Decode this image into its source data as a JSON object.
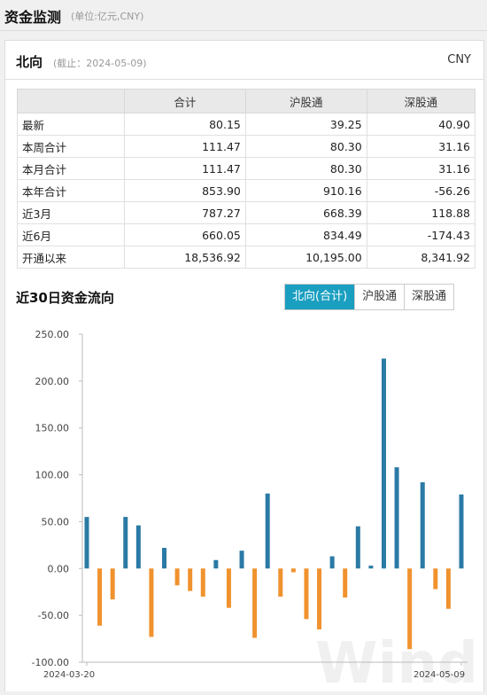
{
  "header": {
    "title": "资金监测",
    "unit": "(单位:亿元,CNY)"
  },
  "north": {
    "title": "北向",
    "as_of": "(截止：2024-05-09)",
    "currency": "CNY",
    "columns": [
      "",
      "合计",
      "沪股通",
      "深股通"
    ],
    "rows": [
      [
        "最新",
        "80.15",
        "39.25",
        "40.90"
      ],
      [
        "本周合计",
        "111.47",
        "80.30",
        "31.16"
      ],
      [
        "本月合计",
        "111.47",
        "80.30",
        "31.16"
      ],
      [
        "本年合计",
        "853.90",
        "910.16",
        "-56.26"
      ],
      [
        "近3月",
        "787.27",
        "668.39",
        "118.88"
      ],
      [
        "近6月",
        "660.05",
        "834.49",
        "-174.43"
      ],
      [
        "开通以来",
        "18,536.92",
        "10,195.00",
        "8,341.92"
      ]
    ]
  },
  "flow": {
    "title": "近30日资金流向",
    "tabs": [
      "北向(合计)",
      "沪股通",
      "深股通"
    ],
    "active_tab": 0
  },
  "colors": {
    "positive": "#2a7aa5",
    "negative": "#f0922e",
    "tab_active": "#1a9fc0"
  },
  "watermark": "Wind",
  "chart_data": {
    "type": "bar",
    "x_start_label": "2024-03-20",
    "x_end_label": "2024-05-09",
    "ylim": [
      -100,
      250
    ],
    "yticks": [
      "-100.00",
      "-50.00",
      "0.00",
      "50.00",
      "100.00",
      "150.00",
      "200.00",
      "250.00"
    ],
    "values": [
      55,
      -61,
      -33,
      55,
      46,
      -73,
      22,
      -18,
      -24,
      -30,
      9,
      -42,
      19,
      -74,
      80,
      -30,
      -4,
      -54,
      -65,
      13,
      -31,
      45,
      3,
      224,
      108,
      -86,
      92,
      -22,
      -43,
      79
    ],
    "grid": false
  }
}
